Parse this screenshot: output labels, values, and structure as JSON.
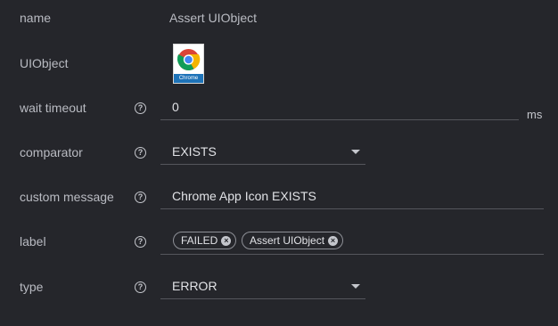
{
  "form": {
    "name": {
      "label": "name",
      "value": "Assert UIObject"
    },
    "uiobject": {
      "label": "UIObject",
      "icon": "chrome-icon",
      "caption": "Chrome"
    },
    "wait_timeout": {
      "label": "wait timeout",
      "value": "0",
      "suffix": "ms"
    },
    "comparator": {
      "label": "comparator",
      "value": "EXISTS"
    },
    "custom_message": {
      "label": "custom message",
      "value": "Chrome App Icon EXISTS"
    },
    "label": {
      "label": "label",
      "chips": [
        "FAILED",
        "Assert UIObject"
      ]
    },
    "type": {
      "label": "type",
      "value": "ERROR"
    }
  },
  "help_glyph": "?",
  "chip_remove_glyph": "×",
  "colors": {
    "background": "#25262b",
    "underline": "#55565c",
    "chrome_caption": "#1e73b8"
  }
}
